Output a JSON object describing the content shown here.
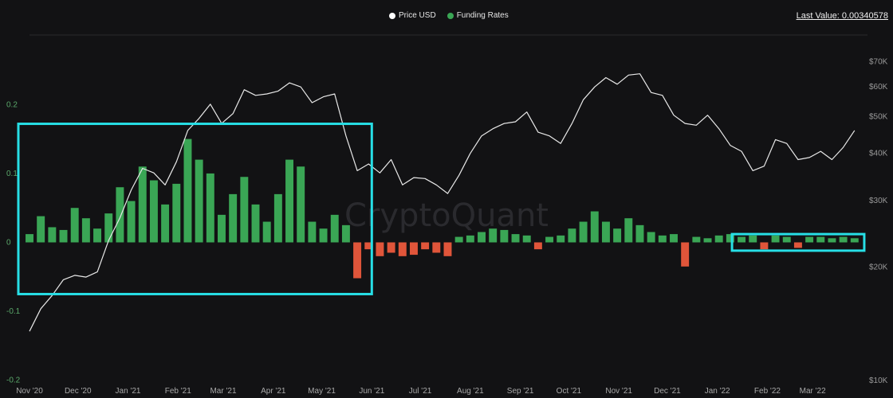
{
  "header": {
    "last_value_label": "Last Value: 0.00340578"
  },
  "legend": [
    {
      "name": "Price USD",
      "color": "#ffffff"
    },
    {
      "name": "Funding Rates",
      "color": "#3aa655"
    }
  ],
  "watermark": "CryptoQuant",
  "colors": {
    "background": "#121214",
    "grid": "#2a2a2d",
    "price_line": "#e8e8e8",
    "positive_bar": "#3aa655",
    "negative_bar": "#e0553a",
    "highlight_box": "#27dfe6",
    "left_axis": "#5aa86a",
    "right_axis": "#9a9a9a"
  },
  "chart_data": {
    "type": "bar",
    "x_ticks": [
      "Nov '20",
      "Dec '20",
      "Jan '21",
      "Feb '21",
      "Mar '21",
      "Apr '21",
      "May '21",
      "Jun '21",
      "Jul '21",
      "Aug '21",
      "Sep '21",
      "Oct '21",
      "Nov '21",
      "Dec '21",
      "Jan '22",
      "Feb '22",
      "Mar '22"
    ],
    "y_left": {
      "ticks": [
        "0.2",
        "0.1",
        "0",
        "-0.1",
        "-0.2"
      ],
      "values": [
        0.2,
        0.1,
        0,
        -0.1,
        -0.2
      ],
      "range": [
        -0.2,
        0.2
      ]
    },
    "y_right": {
      "scale": "log",
      "ticks": [
        "$70K",
        "$60K",
        "$50K",
        "$40K",
        "$30K",
        "$20K",
        "$10K"
      ],
      "values": [
        70000,
        60000,
        50000,
        40000,
        30000,
        20000,
        10000
      ],
      "range": [
        10000,
        80000
      ]
    },
    "series": [
      {
        "name": "Price USD",
        "type": "line",
        "axis": "right",
        "dates": [
          "2020-11-01",
          "2020-11-08",
          "2020-11-15",
          "2020-11-22",
          "2020-11-29",
          "2020-12-06",
          "2020-12-13",
          "2020-12-20",
          "2020-12-27",
          "2021-01-03",
          "2021-01-10",
          "2021-01-17",
          "2021-01-24",
          "2021-01-31",
          "2021-02-07",
          "2021-02-14",
          "2021-02-21",
          "2021-02-28",
          "2021-03-07",
          "2021-03-14",
          "2021-03-21",
          "2021-03-28",
          "2021-04-04",
          "2021-04-11",
          "2021-04-18",
          "2021-04-25",
          "2021-05-02",
          "2021-05-09",
          "2021-05-16",
          "2021-05-23",
          "2021-05-30",
          "2021-06-06",
          "2021-06-13",
          "2021-06-20",
          "2021-06-27",
          "2021-07-04",
          "2021-07-11",
          "2021-07-18",
          "2021-07-25",
          "2021-08-01",
          "2021-08-08",
          "2021-08-15",
          "2021-08-22",
          "2021-08-29",
          "2021-09-05",
          "2021-09-12",
          "2021-09-19",
          "2021-09-26",
          "2021-10-03",
          "2021-10-10",
          "2021-10-17",
          "2021-10-24",
          "2021-10-31",
          "2021-11-07",
          "2021-11-14",
          "2021-11-21",
          "2021-11-28",
          "2021-12-05",
          "2021-12-12",
          "2021-12-19",
          "2021-12-26",
          "2022-01-02",
          "2022-01-09",
          "2022-01-16",
          "2022-01-23",
          "2022-01-30",
          "2022-02-06",
          "2022-02-13",
          "2022-02-20",
          "2022-02-27",
          "2022-03-06",
          "2022-03-13",
          "2022-03-20",
          "2022-03-27"
        ],
        "values": [
          13500,
          15500,
          16800,
          18500,
          19000,
          18800,
          19400,
          23500,
          27000,
          32000,
          36500,
          35500,
          33000,
          38000,
          46000,
          49500,
          54000,
          48000,
          51000,
          59000,
          57000,
          57500,
          58500,
          61500,
          60000,
          54500,
          56500,
          57500,
          44500,
          36000,
          37500,
          35500,
          38500,
          33000,
          34500,
          34300,
          33000,
          31300,
          35000,
          40000,
          44500,
          46500,
          48000,
          48500,
          51500,
          45500,
          44500,
          42500,
          48000,
          55500,
          60000,
          63500,
          61000,
          64500,
          65000,
          58000,
          57000,
          50500,
          48000,
          47500,
          50500,
          46500,
          42000,
          40500,
          36000,
          37000,
          43500,
          42500,
          38500,
          39000,
          40500,
          38500,
          41500,
          46000
        ]
      },
      {
        "name": "Funding Rates",
        "type": "bar",
        "axis": "left",
        "description_values": "weekly representative peaks",
        "dates": [
          "2020-11-01",
          "2020-11-08",
          "2020-11-15",
          "2020-11-22",
          "2020-11-29",
          "2020-12-06",
          "2020-12-13",
          "2020-12-20",
          "2020-12-27",
          "2021-01-03",
          "2021-01-10",
          "2021-01-17",
          "2021-01-24",
          "2021-01-31",
          "2021-02-07",
          "2021-02-14",
          "2021-02-21",
          "2021-02-28",
          "2021-03-07",
          "2021-03-14",
          "2021-03-21",
          "2021-03-28",
          "2021-04-04",
          "2021-04-11",
          "2021-04-18",
          "2021-04-25",
          "2021-05-02",
          "2021-05-09",
          "2021-05-16",
          "2021-05-23",
          "2021-05-30",
          "2021-06-06",
          "2021-06-13",
          "2021-06-20",
          "2021-06-27",
          "2021-07-04",
          "2021-07-11",
          "2021-07-18",
          "2021-07-25",
          "2021-08-01",
          "2021-08-08",
          "2021-08-15",
          "2021-08-22",
          "2021-08-29",
          "2021-09-05",
          "2021-09-12",
          "2021-09-19",
          "2021-09-26",
          "2021-10-03",
          "2021-10-10",
          "2021-10-17",
          "2021-10-24",
          "2021-10-31",
          "2021-11-07",
          "2021-11-14",
          "2021-11-21",
          "2021-11-28",
          "2021-12-05",
          "2021-12-12",
          "2021-12-19",
          "2021-12-26",
          "2022-01-02",
          "2022-01-09",
          "2022-01-16",
          "2022-01-23",
          "2022-01-30",
          "2022-02-06",
          "2022-02-13",
          "2022-02-20",
          "2022-02-27",
          "2022-03-06",
          "2022-03-13",
          "2022-03-20",
          "2022-03-27"
        ],
        "values": [
          0.012,
          0.038,
          0.022,
          0.018,
          0.05,
          0.035,
          0.02,
          0.042,
          0.08,
          0.06,
          0.11,
          0.09,
          0.055,
          0.085,
          0.15,
          0.12,
          0.1,
          0.04,
          0.07,
          0.095,
          0.055,
          0.03,
          0.07,
          0.12,
          0.11,
          0.03,
          0.02,
          0.04,
          0.025,
          -0.052,
          -0.01,
          -0.02,
          -0.015,
          -0.02,
          -0.018,
          -0.01,
          -0.015,
          -0.02,
          0.008,
          0.01,
          0.015,
          0.02,
          0.018,
          0.012,
          0.01,
          -0.01,
          0.008,
          0.01,
          0.02,
          0.03,
          0.045,
          0.03,
          0.02,
          0.035,
          0.025,
          0.015,
          0.01,
          0.012,
          -0.035,
          0.008,
          0.006,
          0.01,
          0.012,
          0.008,
          0.01,
          -0.01,
          0.01,
          0.008,
          -0.008,
          0.008,
          0.008,
          0.006,
          0.008,
          0.006
        ]
      }
    ],
    "annotations": [
      {
        "type": "highlight-box",
        "from": "2020-11-01",
        "to": "2021-06-01",
        "y_from": -0.075,
        "y_to": 0.172
      },
      {
        "type": "highlight-box",
        "from": "2022-01-17",
        "to": "2022-04-02",
        "y_from": -0.012,
        "y_to": 0.012
      }
    ]
  }
}
